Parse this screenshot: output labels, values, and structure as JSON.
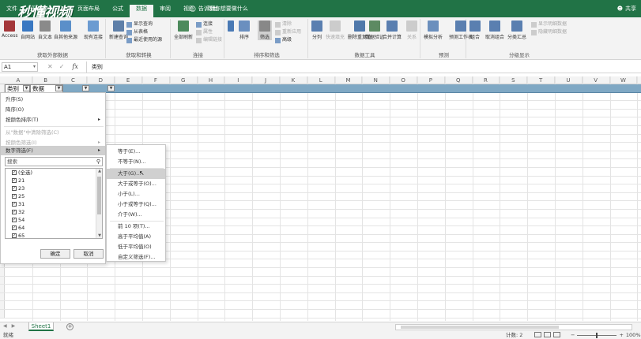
{
  "logo": {
    "text": "秒懂视频"
  },
  "ribbon_tabs": [
    "文件",
    "开始",
    "插入",
    "页面布局",
    "公式",
    "数据",
    "审阅",
    "视图",
    "帮助"
  ],
  "active_tab_index": 5,
  "tell_me": "告诉我你想要做什么",
  "share": "共享",
  "ribbon": {
    "groups": [
      {
        "label": "获取外部数据",
        "buttons": [
          "Access",
          "自网站",
          "自文本",
          "自其他来源",
          "现有连接"
        ]
      },
      {
        "label": "获取和转换",
        "buttons": [
          "新建查询"
        ],
        "small": [
          "显示查询",
          "从表格",
          "最近使用的源"
        ]
      },
      {
        "label": "连接",
        "buttons": [
          "全部刷新"
        ],
        "small": [
          "连接",
          "属性",
          "编辑链接"
        ]
      },
      {
        "label": "排序和筛选",
        "buttons": [
          "排序",
          "筛选"
        ],
        "small": [
          "清除",
          "重新应用",
          "高级"
        ]
      },
      {
        "label": "数据工具",
        "buttons": [
          "分列",
          "快速填充",
          "删除重复值",
          "数据验证",
          "合并计算",
          "关系"
        ]
      },
      {
        "label": "预测",
        "buttons": [
          "模拟分析",
          "预测工作表"
        ]
      },
      {
        "label": "分级显示",
        "buttons": [
          "组合",
          "取消组合",
          "分类汇总"
        ],
        "small": [
          "显示明细数据",
          "隐藏明细数据"
        ]
      }
    ]
  },
  "formula_bar": {
    "name_box": "A1",
    "fx": "fx",
    "content": "类别"
  },
  "columns": [
    "A",
    "B",
    "C",
    "D",
    "E",
    "F",
    "G",
    "H",
    "I",
    "J",
    "K",
    "L",
    "M",
    "N",
    "O",
    "P",
    "Q",
    "R",
    "S",
    "T",
    "U",
    "V",
    "W"
  ],
  "header_cells": {
    "a1": "类别",
    "b1": "数据"
  },
  "filter_menu": {
    "items": [
      "升序(S)",
      "降序(O)",
      "按颜色排序(T)",
      "从\"数据\"中清除筛选(C)",
      "按颜色筛选(I)",
      "数字筛选(F)"
    ],
    "search_placeholder": "搜索",
    "checks": [
      "(全选)",
      "21",
      "23",
      "25",
      "31",
      "32",
      "54",
      "64",
      "65",
      "81"
    ],
    "ok": "确定",
    "cancel": "取消"
  },
  "number_filter_submenu": {
    "items": [
      "等于(E)...",
      "不等于(N)...",
      "大于(G)...",
      "大于或等于(O)...",
      "小于(L)...",
      "小于或等于(Q)...",
      "介于(W)...",
      "前 10 项(T)...",
      "高于平均值(A)",
      "低于平均值(O)",
      "自定义筛选(F)..."
    ],
    "highlighted_index": 2
  },
  "sheet_tab": "Sheet1",
  "status": {
    "ready": "就绪",
    "count": "计数: 2",
    "zoom": "100%"
  },
  "colors": {
    "excel_green": "#217346",
    "ribbon_bg": "#f3f3f3",
    "header_band": "#7fa8c4"
  }
}
